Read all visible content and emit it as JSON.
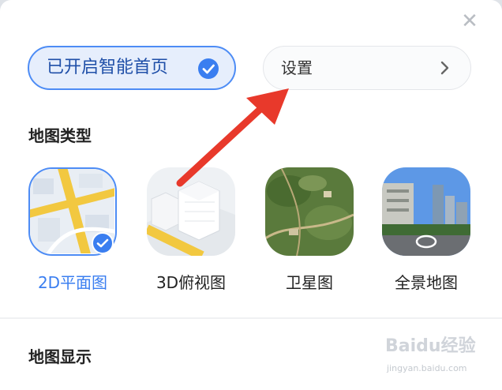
{
  "header": {
    "close_icon": "close-icon",
    "smart_home_label": "已开启智能首页",
    "settings_label": "设置"
  },
  "map_type": {
    "title": "地图类型",
    "options": [
      {
        "label": "2D平面图",
        "selected": true
      },
      {
        "label": "3D俯视图",
        "selected": false
      },
      {
        "label": "卫星图",
        "selected": false
      },
      {
        "label": "全景地图",
        "selected": false
      }
    ]
  },
  "map_display": {
    "title": "地图显示"
  },
  "watermark": {
    "logo_text": "Baidu经验",
    "sub_text": "jingyan.baidu.com"
  },
  "colors": {
    "accent": "#3a7ef0",
    "annotation_arrow": "#e8392b"
  }
}
